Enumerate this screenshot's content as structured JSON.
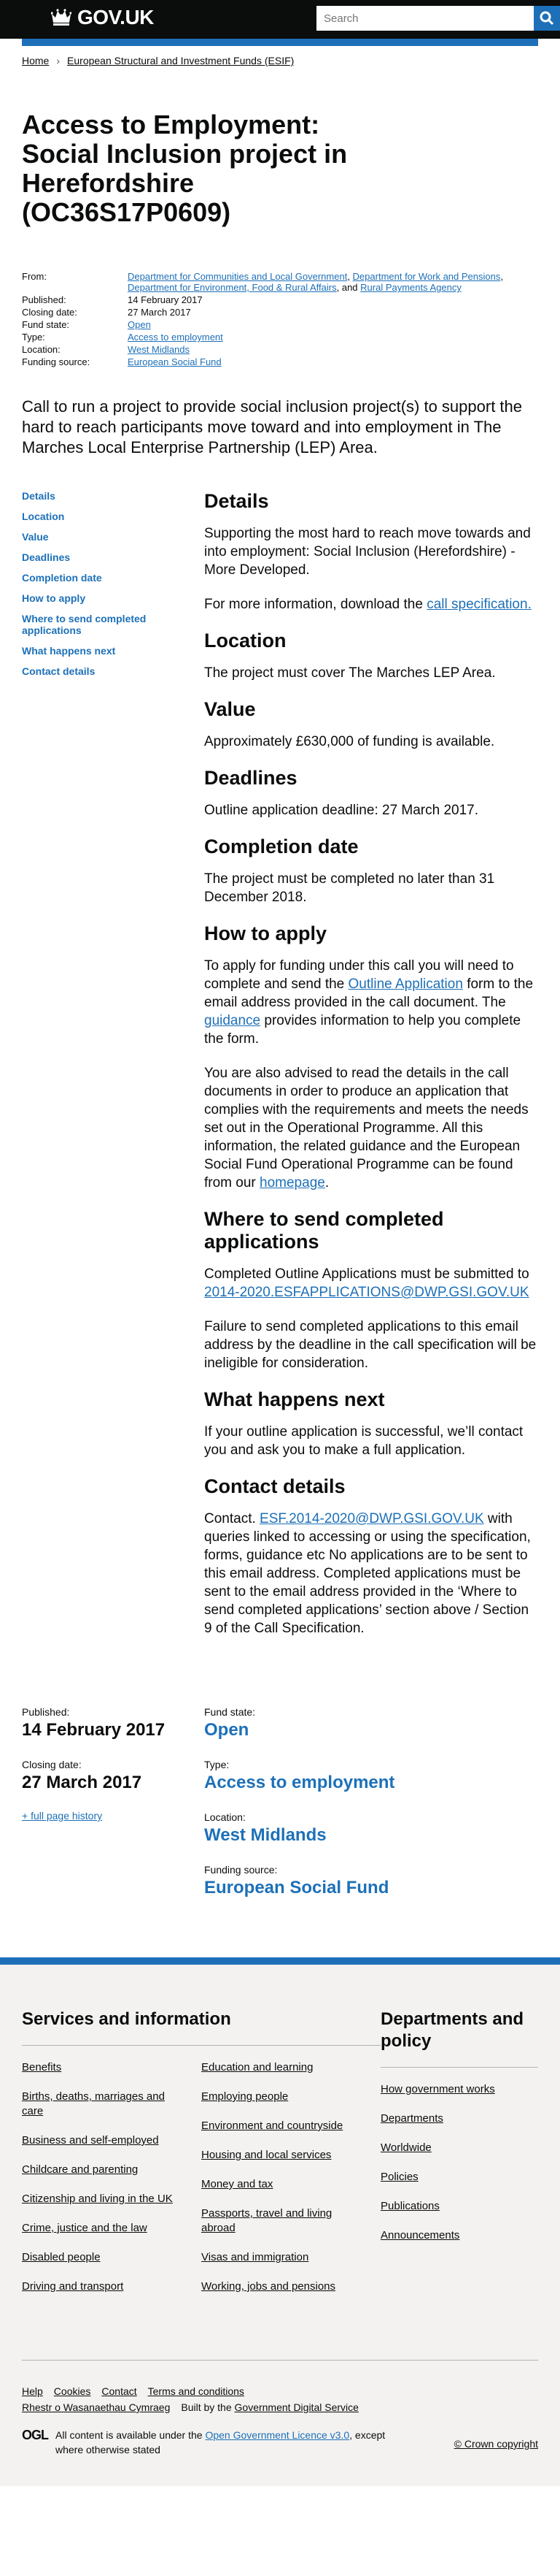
{
  "header": {
    "logo_text": "GOV.UK",
    "search_placeholder": "Search",
    "search_button_label": "Search"
  },
  "breadcrumbs": [
    "Home",
    "European Structural and Investment Funds (ESIF)"
  ],
  "title": "Access to Employment: Social Inclusion project in Herefordshire (OC36S17P0609)",
  "metadata": {
    "from_label": "From:",
    "from_links": [
      "Department for Communities and Local Government",
      "Department for Work and Pensions",
      "Department for Environment, Food & Rural Affairs",
      "Rural Payments Agency"
    ],
    "from_and": ", and ",
    "from_sep": ", ",
    "published_label": "Published:",
    "published_value": "14 February 2017",
    "closing_label": "Closing date:",
    "closing_value": "27 March 2017",
    "fund_state_label": "Fund state:",
    "fund_state_value": "Open",
    "type_label": "Type:",
    "type_value": "Access to employment",
    "location_label": "Location:",
    "location_value": "West Midlands",
    "funding_label": "Funding source:",
    "funding_value": "European Social Fund"
  },
  "summary": "Call to run a project to provide social inclusion project(s) to support the hard to reach participants move toward and into employment in The Marches Local Enterprise Partnership (LEP) Area.",
  "toc": [
    "Details",
    "Location",
    "Value",
    "Deadlines",
    "Completion date",
    "How to apply",
    "Where to send completed applications",
    "What happens next",
    "Contact details"
  ],
  "sections": {
    "details": {
      "heading": "Details",
      "p1": "Supporting the most hard to reach move towards and into employment: Social Inclusion (Herefordshire) - More Developed.",
      "p2_pre": "For more information, download the ",
      "p2_link": "call specification."
    },
    "location": {
      "heading": "Location",
      "p1": "The project must cover The Marches LEP Area."
    },
    "value": {
      "heading": "Value",
      "p1": "Approximately £630,000 of funding is available."
    },
    "deadlines": {
      "heading": "Deadlines",
      "p1": "Outline application deadline: 27 March 2017."
    },
    "completion": {
      "heading": "Completion date",
      "p1": "The project must be completed no later than 31 December 2018."
    },
    "how_to_apply": {
      "heading": "How to apply",
      "p1_a": "To apply for funding under this call you will need to complete and send the ",
      "p1_link1": "Outline Application",
      "p1_b": " form to the email address provided in the call document. The ",
      "p1_link2": "guidance",
      "p1_c": " provides information to help you complete the form.",
      "p2_a": "You are also advised to read the details in the call documents in order to produce an application that complies with the requirements and meets the needs set out in the Operational Programme. All this information, the related guidance and the European Social Fund Operational Programme can be found from our ",
      "p2_link": "homepage",
      "p2_b": "."
    },
    "where_to_send": {
      "heading": "Where to send completed applications",
      "p1_a": "Completed Outline Applications must be submitted to ",
      "p1_link": "2014-2020.ESFAPPLICATIONS@DWP.GSI.GOV.UK",
      "p2": "Failure to send completed applications to this email address by the deadline in the call specification will be ineligible for consideration."
    },
    "what_next": {
      "heading": "What happens next",
      "p1": "If your outline application is successful, we’ll contact you and ask you to make a full application."
    },
    "contact": {
      "heading": "Contact details",
      "p1_a": "Contact. ",
      "p1_link": "ESF.2014-2020@DWP.GSI.GOV.UK",
      "p1_b": " with queries linked to accessing or using the specification, forms, guidance etc No applications are to be sent to this email address. Completed applications must be sent to the email address provided in the ‘Where to send completed applications’ section above / Section 9 of the Call Specification."
    }
  },
  "bottom_meta": {
    "published_label": "Published:",
    "published_value": "14 February 2017",
    "closing_label": "Closing date:",
    "closing_value": "27 March 2017",
    "history_link": "+ full page history",
    "fund_state_label": "Fund state:",
    "fund_state_value": "Open",
    "type_label": "Type:",
    "type_value": "Access to employment",
    "location_label": "Location:",
    "location_value": "West Midlands",
    "funding_label": "Funding source:",
    "funding_value": "European Social Fund"
  },
  "footer": {
    "services_heading": "Services and information",
    "services_col1": [
      "Benefits",
      "Births, deaths, marriages and care",
      "Business and self-employed",
      "Childcare and parenting",
      "Citizenship and living in the UK",
      "Crime, justice and the law",
      "Disabled people",
      "Driving and transport"
    ],
    "services_col2": [
      "Education and learning",
      "Employing people",
      "Environment and countryside",
      "Housing and local services",
      "Money and tax",
      "Passports, travel and living abroad",
      "Visas and immigration",
      "Working, jobs and pensions"
    ],
    "departments_heading": "Departments and policy",
    "departments_links": [
      "How government works",
      "Departments",
      "Worldwide",
      "Policies",
      "Publications",
      "Announcements"
    ],
    "meta_links": [
      "Help",
      "Cookies",
      "Contact",
      "Terms and conditions"
    ],
    "welsh_link": "Rhestr o Wasanaethau Cymraeg",
    "built_by_pre": "Built by the ",
    "built_by_link": "Government Digital Service",
    "ogl_text": "OGL",
    "licence_pre": "All content is available under the ",
    "licence_link": "Open Government Licence v3.0",
    "licence_post": ", except where otherwise stated",
    "copyright": "© Crown copyright"
  },
  "colors": {
    "link": "#1d70b8",
    "header": "#0b0c0c",
    "footer_bg": "#f3f2f1"
  }
}
